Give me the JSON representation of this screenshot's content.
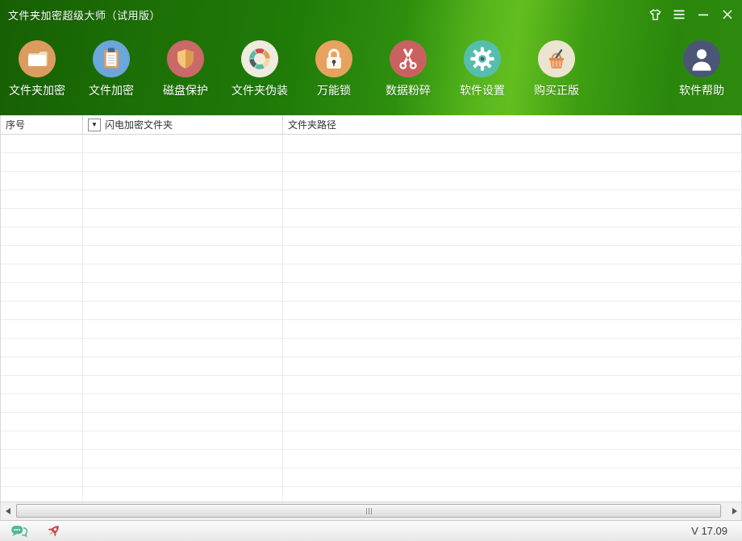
{
  "titlebar": {
    "title": "文件夹加密超级大师（试用版）",
    "controls": {
      "skin": "shirt-icon",
      "menu": "hamburger-icon",
      "minimize": "minimize-icon",
      "close": "close-icon"
    }
  },
  "toolbar": {
    "buttons": [
      {
        "label": "文件夹加密",
        "icon": "folder-icon",
        "circle_color": "#DD9C5F"
      },
      {
        "label": "文件加密",
        "icon": "clipboard-icon",
        "circle_color": "#6BA7D9"
      },
      {
        "label": "磁盘保护",
        "icon": "shield-icon",
        "circle_color": "#CB6868"
      },
      {
        "label": "文件夹伪装",
        "icon": "color-ring-icon",
        "circle_color": "#EFEBDE"
      },
      {
        "label": "万能锁",
        "icon": "lock-icon",
        "circle_color": "#E6A35F"
      },
      {
        "label": "数据粉碎",
        "icon": "scissors-icon",
        "circle_color": "#CA6161"
      },
      {
        "label": "软件设置",
        "icon": "gear-icon",
        "circle_color": "#57BDAD"
      },
      {
        "label": "购买正版",
        "icon": "basket-icon",
        "circle_color": "#EBE4D1"
      },
      {
        "label": "软件帮助",
        "icon": "user-icon",
        "circle_color": "#4B5677"
      }
    ]
  },
  "table": {
    "columns": [
      {
        "label": "序号"
      },
      {
        "label": "闪电加密文件夹",
        "has_filter": true,
        "filter_icon": "filter-dropdown-icon",
        "filter_glyph": "▼"
      },
      {
        "label": "文件夹路径"
      }
    ],
    "rows": []
  },
  "statusbar": {
    "icons": [
      "chat-icon",
      "rocket-icon"
    ],
    "version": "V 17.09"
  },
  "colors": {
    "title_green_dark": "#1C6F06",
    "title_green_bright": "#63BE1F",
    "accent_teal": "#4DB89A",
    "accent_red": "#C54B57"
  }
}
